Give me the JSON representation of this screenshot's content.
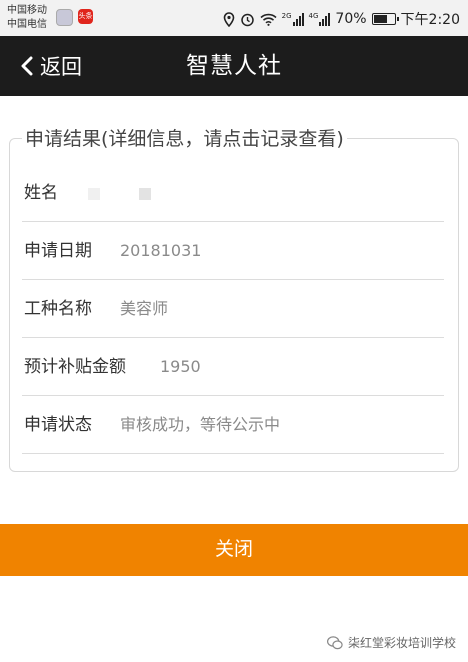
{
  "status_bar": {
    "carrier1": "中国移动",
    "carrier2": "中国电信",
    "app_badge": "头条",
    "network_1": "2G",
    "network_2": "4G",
    "battery": "70%",
    "time": "下午2:20"
  },
  "nav": {
    "back_label": "返回",
    "title": "智慧人社"
  },
  "result": {
    "legend": "申请结果(详细信息，请点击记录查看)",
    "rows": [
      {
        "label": "姓名",
        "value": ""
      },
      {
        "label": "申请日期",
        "value": "20181031"
      },
      {
        "label": "工种名称",
        "value": "美容师"
      },
      {
        "label": "预计补贴金额",
        "value": "1950"
      },
      {
        "label": "申请状态",
        "value": "审核成功，等待公示中"
      }
    ]
  },
  "close_label": "关闭",
  "watermark": "柒红堂彩妆培训学校",
  "colors": {
    "accent": "#f08300",
    "navbar": "#1c1c1c"
  }
}
